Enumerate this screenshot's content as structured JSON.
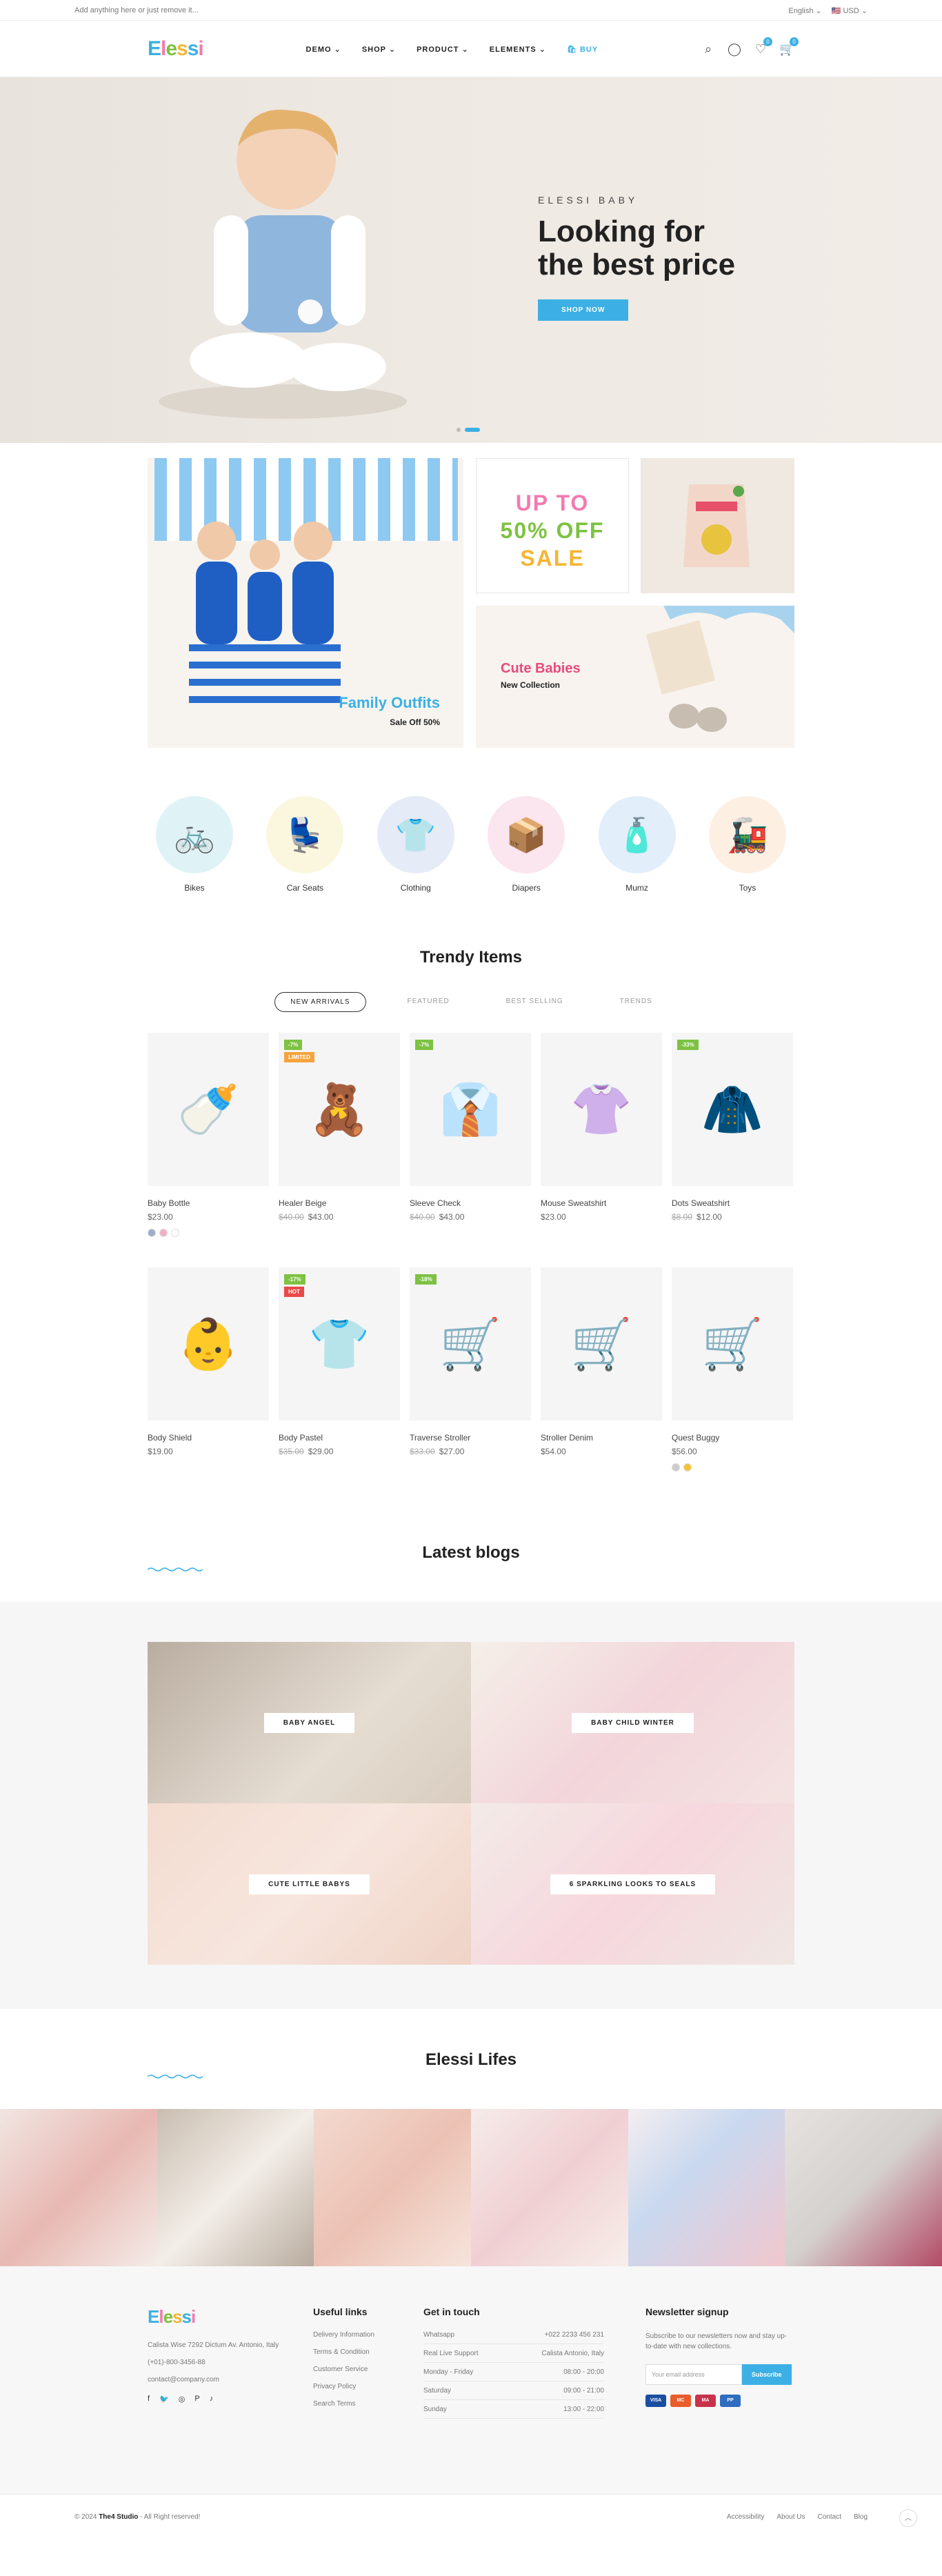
{
  "topbar": {
    "notice": "Add anything here or just remove it...",
    "language": "English",
    "currency": "USD"
  },
  "header": {
    "logo": [
      "E",
      "l",
      "e",
      "s",
      "s",
      "i"
    ],
    "nav": [
      "DEMO",
      "SHOP",
      "PRODUCT",
      "ELEMENTS"
    ],
    "buy": "BUY",
    "wishlist_count": "0",
    "cart_count": "0"
  },
  "hero": {
    "subtitle": "ELESSI BABY",
    "title_line1": "Looking for",
    "title_line2": "the best price",
    "button": "SHOP NOW"
  },
  "promos": {
    "family_title": "Family Outfits",
    "family_sub": "Sale Off 50%",
    "sale_line1": "UP TO",
    "sale_line2": "50% OFF",
    "sale_line3": "SALE",
    "cute_title": "Cute Babies",
    "cute_sub": "New Collection"
  },
  "categories": [
    {
      "label": "Bikes",
      "icon": "bike-icon",
      "glyph": "🚲",
      "bg": "#dff3f7"
    },
    {
      "label": "Car Seats",
      "icon": "car-seat-icon",
      "glyph": "💺",
      "bg": "#fbf7de"
    },
    {
      "label": "Clothing",
      "icon": "clothing-icon",
      "glyph": "👕",
      "bg": "#e5ebf7"
    },
    {
      "label": "Diapers",
      "icon": "diapers-icon",
      "glyph": "📦",
      "bg": "#fbe5ee"
    },
    {
      "label": "Mumz",
      "icon": "bottles-icon",
      "glyph": "🧴",
      "bg": "#e2eefa"
    },
    {
      "label": "Toys",
      "icon": "toy-train-icon",
      "glyph": "🚂",
      "bg": "#fdf0e3"
    }
  ],
  "trendy": {
    "title": "Trendy Items",
    "tabs": [
      "NEW ARRIVALS",
      "FEATURED",
      "BEST SELLING",
      "TRENDS"
    ],
    "products": [
      {
        "name": "Baby Bottle",
        "price": "$23.00",
        "old": "",
        "tags": [],
        "glyph": "🍼",
        "swatches": [
          "#9bb0c8",
          "#f0b0c8",
          "#ffffff"
        ]
      },
      {
        "name": "Healer Beige",
        "price": "$43.00",
        "old": "$40.00",
        "tags": [
          {
            "t": "-7%",
            "c": "#7dc242"
          },
          {
            "t": "LIMITED",
            "c": "#f6a33c"
          }
        ],
        "glyph": "🧸",
        "swatches": []
      },
      {
        "name": "Sleeve Check",
        "price": "$43.00",
        "old": "$40.00",
        "tags": [
          {
            "t": "-7%",
            "c": "#7dc242"
          }
        ],
        "glyph": "👔",
        "swatches": []
      },
      {
        "name": "Mouse Sweatshirt",
        "price": "$23.00",
        "old": "",
        "tags": [],
        "glyph": "👚",
        "swatches": []
      },
      {
        "name": "Dots Sweatshirt",
        "price": "$12.00",
        "old": "$8.00",
        "tags": [
          {
            "t": "-33%",
            "c": "#7dc242"
          }
        ],
        "glyph": "🧥",
        "swatches": []
      },
      {
        "name": "Body Shield",
        "price": "$19.00",
        "old": "",
        "tags": [],
        "glyph": "👶",
        "swatches": []
      },
      {
        "name": "Body Pastel",
        "price": "$29.00",
        "old": "$35.00",
        "tags": [
          {
            "t": "-17%",
            "c": "#7dc242"
          },
          {
            "t": "HOT",
            "c": "#e84a4a"
          }
        ],
        "glyph": "👕",
        "swatches": []
      },
      {
        "name": "Traverse Stroller",
        "price": "$27.00",
        "old": "$33.00",
        "tags": [
          {
            "t": "-18%",
            "c": "#7dc242"
          }
        ],
        "glyph": "🛒",
        "swatches": []
      },
      {
        "name": "Stroller Denim",
        "price": "$54.00",
        "old": "",
        "tags": [],
        "glyph": "🛒",
        "swatches": []
      },
      {
        "name": "Quest Buggy",
        "price": "$56.00",
        "old": "",
        "tags": [],
        "glyph": "🛒",
        "swatches": [
          "#cccccc",
          "#f6c234"
        ]
      }
    ]
  },
  "blogs": {
    "title": "Latest blogs",
    "posts": [
      "BABY ANGEL",
      "BABY CHILD WINTER",
      "CUTE LITTLE BABYS",
      "6 SPARKLING LOOKS TO SEALS"
    ]
  },
  "lifes": {
    "title": "Elessi Lifes"
  },
  "footer": {
    "address": "Calista Wise 7292 Dictum Av. Antonio, Italy",
    "phone": "(+01)-800-3456-88",
    "email": "contact@company.com",
    "useful_title": "Useful links",
    "useful": [
      "Delivery Information",
      "Terms & Condition",
      "Customer Service",
      "Privacy Policy",
      "Search Terms"
    ],
    "contact_title": "Get in touch",
    "contact": [
      {
        "k": "Whatsapp",
        "v": "+022 2233 456 231"
      },
      {
        "k": "Real Live Support",
        "v": "Calista Antonio, Italy"
      },
      {
        "k": "Monday - Friday",
        "v": "08:00 - 20:00"
      },
      {
        "k": "Saturday",
        "v": "09:00 - 21:00"
      },
      {
        "k": "Sunday",
        "v": "13:00 - 22:00"
      }
    ],
    "newsletter_title": "Newsletter signup",
    "newsletter_text": "Subscribe to our newsletters now and stay up-to-date with new collections.",
    "email_placeholder": "Your email address",
    "subscribe": "Subscribe",
    "copyright_prefix": "© 2024",
    "copyright_brand": "The4 Studio",
    "copyright_suffix": "- All Right reserved!",
    "bottom_links": [
      "Accessibility",
      "About Us",
      "Contact",
      "Blog"
    ]
  }
}
